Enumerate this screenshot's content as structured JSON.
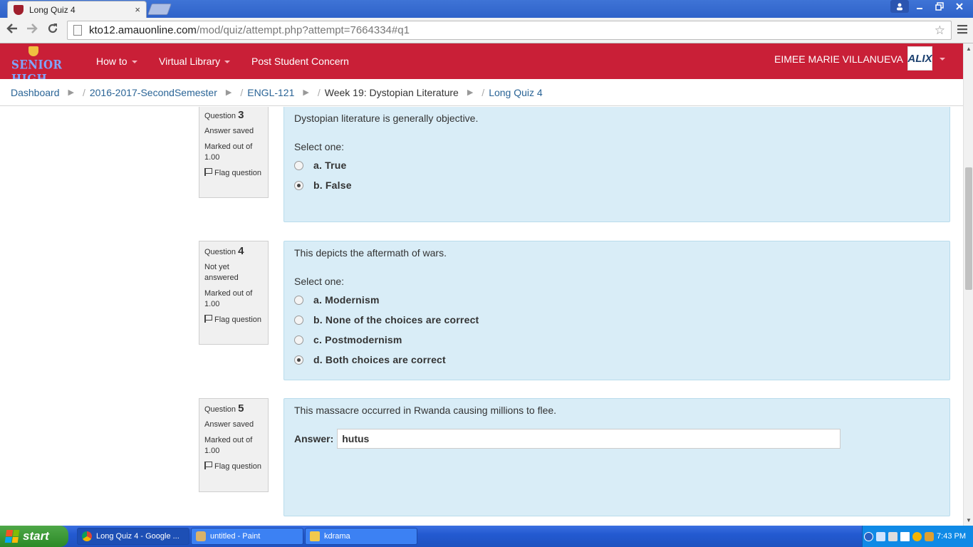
{
  "browser": {
    "tab_title": "Long Quiz 4",
    "tab_close": "×",
    "url_host": "kto12.amauonline.com",
    "url_path": "/mod/quiz/attempt.php?attempt=7664334#q1"
  },
  "navbar": {
    "logo_text": "SENIOR HIGH",
    "items": [
      {
        "label": "How to"
      },
      {
        "label": "Virtual Library"
      },
      {
        "label": "Post Student Concern"
      }
    ],
    "user_name": "EIMEE MARIE VILLANUEVA",
    "avatar_text": "ALIX"
  },
  "breadcrumb": [
    {
      "label": "Dashboard"
    },
    {
      "label": "2016-2017-SecondSemester"
    },
    {
      "label": "ENGL-121"
    },
    {
      "label": "Week 19: Dystopian Literature"
    },
    {
      "label": "Long Quiz 4"
    }
  ],
  "breadcrumb_sep": "▶",
  "breadcrumb_slash": "/",
  "questions": [
    {
      "label": "Question",
      "number": "3",
      "status": "Answer saved",
      "marked": "Marked out of 1.00",
      "flag": "Flag question",
      "text": "Dystopian literature is generally objective.",
      "select_one": "Select one:",
      "options": [
        {
          "label": "a. True",
          "checked": false
        },
        {
          "label": "b. False",
          "checked": true
        }
      ]
    },
    {
      "label": "Question",
      "number": "4",
      "status": "Not yet answered",
      "marked": "Marked out of 1.00",
      "flag": "Flag question",
      "text": "This depicts the aftermath of wars.",
      "select_one": "Select one:",
      "options": [
        {
          "label": "a. Modernism",
          "checked": false
        },
        {
          "label": "b. None of the choices are correct",
          "checked": false
        },
        {
          "label": "c. Postmodernism",
          "checked": false
        },
        {
          "label": "d. Both choices are correct",
          "checked": true
        }
      ]
    },
    {
      "label": "Question",
      "number": "5",
      "status": "Answer saved",
      "marked": "Marked out of 1.00",
      "flag": "Flag question",
      "text": "This massacre occurred in Rwanda causing millions to flee.",
      "answer_label": "Answer:",
      "answer_value": "hutus"
    }
  ],
  "taskbar": {
    "start_label": "start",
    "tasks": [
      {
        "label": "Long Quiz 4 - Google ..."
      },
      {
        "label": "untitled - Paint"
      },
      {
        "label": "kdrama"
      }
    ],
    "clock": "7:43 PM"
  },
  "colors": {
    "navbar": "#c91f37",
    "question_bg": "#d9edf7",
    "link": "#2a6496"
  }
}
